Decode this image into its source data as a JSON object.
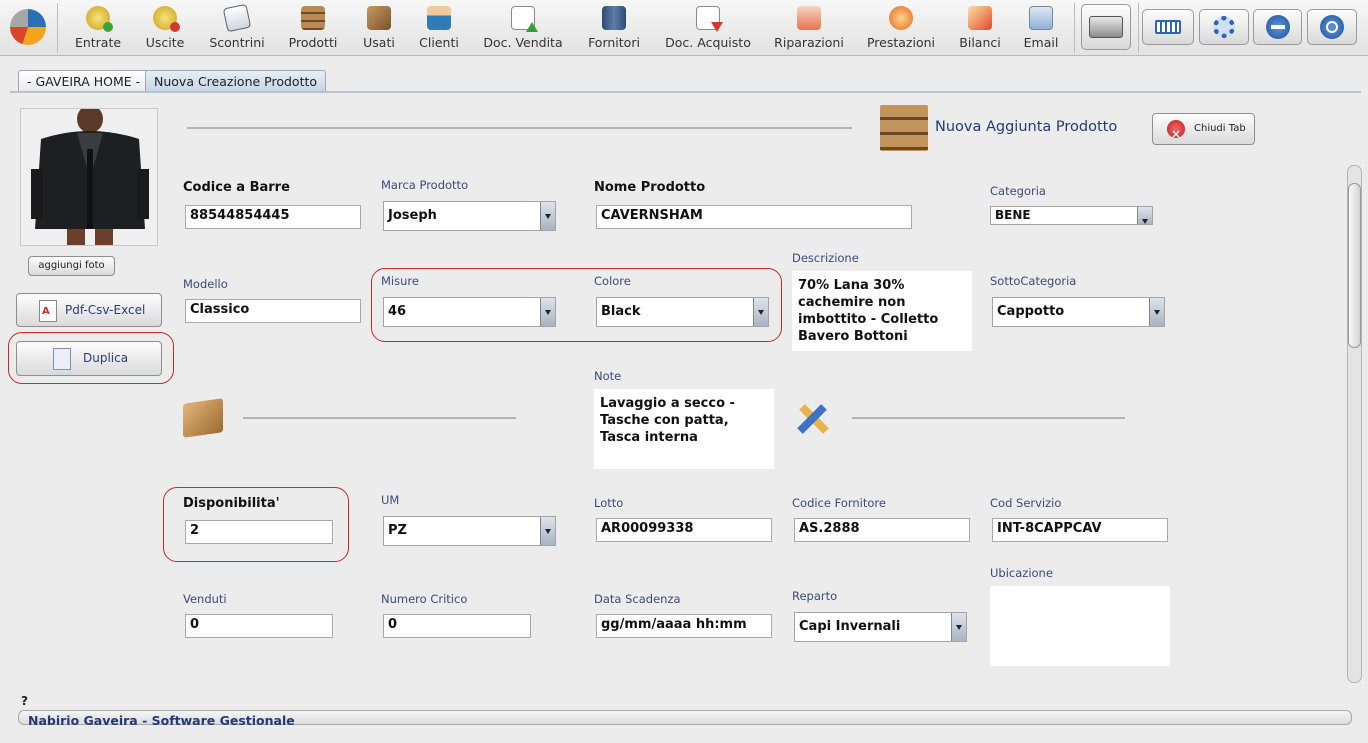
{
  "toolbar": {
    "items": [
      {
        "label": "Entrate",
        "icon": "coin-in-icon"
      },
      {
        "label": "Uscite",
        "icon": "coin-out-icon"
      },
      {
        "label": "Scontrini",
        "icon": "receipt-icon"
      },
      {
        "label": "Prodotti",
        "icon": "shelf-icon"
      },
      {
        "label": "Usati",
        "icon": "box-icon"
      },
      {
        "label": "Clienti",
        "icon": "client-icon"
      },
      {
        "label": "Doc. Vendita",
        "icon": "doc-sale-icon"
      },
      {
        "label": "Fornitori",
        "icon": "supplier-icon"
      },
      {
        "label": "Doc. Acquisto",
        "icon": "doc-purchase-icon"
      },
      {
        "label": "Riparazioni",
        "icon": "repair-icon"
      },
      {
        "label": "Prestazioni",
        "icon": "service-icon"
      },
      {
        "label": "Bilanci",
        "icon": "balance-icon"
      },
      {
        "label": "Email",
        "icon": "email-icon"
      }
    ],
    "right_buttons": [
      "cash-register-icon",
      "keyboard-icon",
      "settings-icon",
      "minimize-icon",
      "power-icon"
    ]
  },
  "tabs": [
    {
      "label": "- GAVEIRA HOME -",
      "active": false
    },
    {
      "label": "Nuova Creazione Prodotto",
      "active": true
    }
  ],
  "left": {
    "add_photo": "aggiungi foto",
    "export": "Pdf-Csv-Excel",
    "duplicate": "Duplica"
  },
  "header": {
    "title": "Nuova Aggiunta Prodotto",
    "close": "Chiudi Tab"
  },
  "form": {
    "barcode": {
      "label": "Codice a Barre",
      "value": "88544854445"
    },
    "brand": {
      "label": "Marca Prodotto",
      "value": "Joseph"
    },
    "name": {
      "label": "Nome Prodotto",
      "value": "CAVERNSHAM"
    },
    "category": {
      "label": "Categoria",
      "value": "BENE"
    },
    "model": {
      "label": "Modello",
      "value": "Classico"
    },
    "size": {
      "label": "Misure",
      "value": "46"
    },
    "color": {
      "label": "Colore",
      "value": "Black"
    },
    "description": {
      "label": "Descrizione",
      "value": "70% Lana 30%\ncachemire non\nimbottito - Colletto\nBavero Bottoni"
    },
    "subcategory": {
      "label": "SottoCategoria",
      "value": "Cappotto"
    },
    "notes": {
      "label": "Note",
      "value": "Lavaggio a secco -\nTasche con patta,\nTasca interna"
    },
    "availability": {
      "label": "Disponibilita'",
      "value": "2"
    },
    "unit": {
      "label": "UM",
      "value": "PZ"
    },
    "lot": {
      "label": "Lotto",
      "value": "AR00099338"
    },
    "supplier_code": {
      "label": "Codice Fornitore",
      "value": "AS.2888"
    },
    "service_code": {
      "label": "Cod Servizio",
      "value": "INT-8CAPPCAV"
    },
    "location": {
      "label": "Ubicazione",
      "value": ""
    },
    "sold": {
      "label": "Venduti",
      "value": "0"
    },
    "critical": {
      "label": "Numero Critico",
      "value": "0"
    },
    "expiry": {
      "label": "Data Scadenza",
      "value": "gg/mm/aaaa hh:mm"
    },
    "department": {
      "label": "Reparto",
      "value": "Capi Invernali"
    }
  },
  "footer": {
    "help": "?",
    "status": "Nabirio Gaveira - Software Gestionale"
  },
  "colors": {
    "highlight": "#c62b2b",
    "label": "#3b4a7a",
    "title": "#233a7a"
  }
}
